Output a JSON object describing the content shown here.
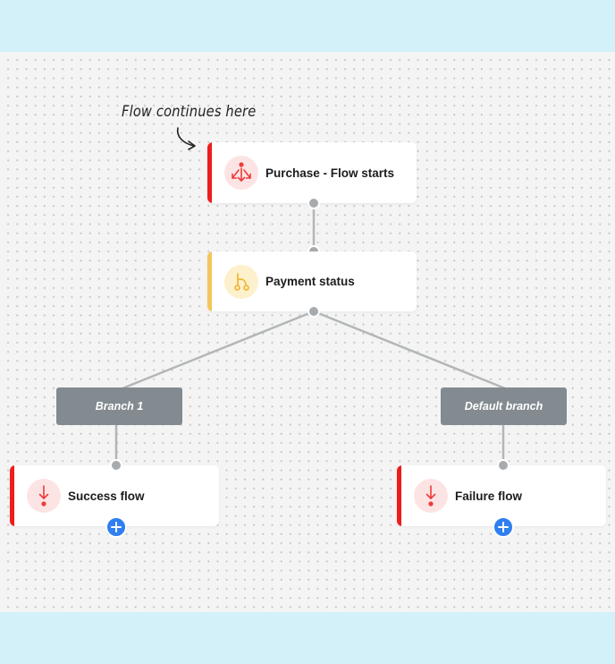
{
  "annotation": {
    "text": "Flow continues here",
    "arrow_icon": "curved-arrow-icon"
  },
  "colors": {
    "page_background": "#d3f1f9",
    "canvas_background": "#f4f4f4",
    "red_accent": "#ee1c1c",
    "red_icon_bg": "#fde4e4",
    "yellow_accent": "#f3c65a",
    "yellow_icon_bg": "#fdf0cc",
    "branch_bg": "#838b90",
    "connector": "#b3b6b8",
    "add_button": "#2f7ff0"
  },
  "nodes": [
    {
      "id": "purchase",
      "label": "Purchase - Flow starts",
      "icon": "split-arrows-icon",
      "accent": "red"
    },
    {
      "id": "payment",
      "label": "Payment status",
      "icon": "branch-icon",
      "accent": "yellow"
    },
    {
      "id": "success",
      "label": "Success flow",
      "icon": "arrow-down-dot-icon",
      "accent": "red"
    },
    {
      "id": "failure",
      "label": "Failure flow",
      "icon": "arrow-down-dot-icon",
      "accent": "red"
    }
  ],
  "branches": [
    {
      "id": "branch1",
      "label": "Branch 1"
    },
    {
      "id": "default",
      "label": "Default branch"
    }
  ],
  "add_buttons": [
    {
      "for": "success",
      "icon": "plus-icon"
    },
    {
      "for": "failure",
      "icon": "plus-icon"
    }
  ]
}
